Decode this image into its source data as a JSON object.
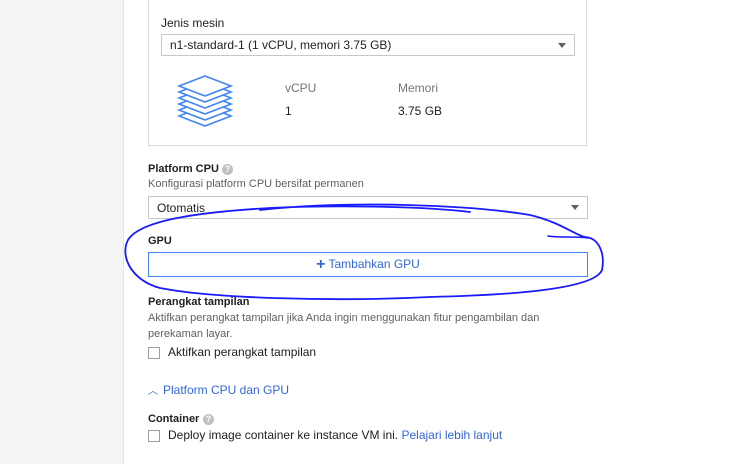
{
  "machine": {
    "label": "Jenis mesin",
    "selected": "n1-standard-1 (1 vCPU, memori 3.75 GB)",
    "vcpu_header": "vCPU",
    "memory_header": "Memori",
    "vcpu_value": "1",
    "memory_value": "3.75 GB"
  },
  "cpu_platform": {
    "title": "Platform CPU",
    "help_glyph": "?",
    "hint": "Konfigurasi platform CPU bersifat permanen",
    "selected": "Otomatis"
  },
  "gpu": {
    "title": "GPU",
    "add_glyph": "+",
    "add_label": "Tambahkan GPU"
  },
  "display_device": {
    "title": "Perangkat tampilan",
    "hint_line1": "Aktifkan perangkat tampilan jika Anda ingin menggunakan fitur pengambilan dan",
    "hint_line2": "perekaman layar.",
    "checkbox_label": "Aktifkan perangkat tampilan",
    "checked": false
  },
  "collapse_link": {
    "chevron": "︿",
    "label": "Platform CPU dan GPU"
  },
  "container": {
    "title": "Container",
    "help_glyph": "?",
    "checkbox_text": "Deploy image container ke instance VM ini.",
    "link_text": "Pelajari lebih lanjut",
    "checked": false
  },
  "colors": {
    "accent": "#4285f4",
    "link": "#3367d6",
    "annotation": "#1a1aff"
  },
  "icons": {
    "machine": "stacked-layers-icon",
    "help": "help-icon",
    "dropdown": "caret-down-icon",
    "add": "plus-icon",
    "collapse": "chevron-up-icon"
  }
}
